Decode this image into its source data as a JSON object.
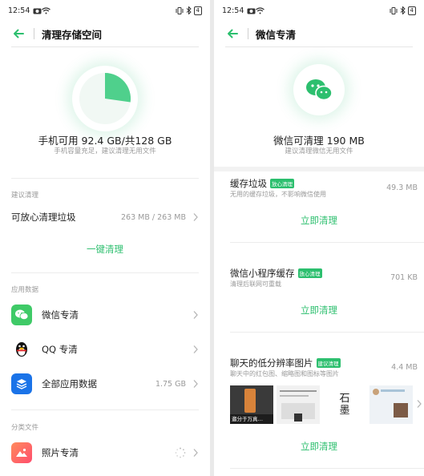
{
  "left": {
    "status": {
      "time": "12:54",
      "battery": "4"
    },
    "header": {
      "title": "清理存储空间"
    },
    "storage": {
      "main": "手机可用 92.4 GB/共128 GB",
      "sub": "手机容量充足，建议清理无用文件"
    },
    "suggest": {
      "label": "建议清理",
      "row_label": "可放心清理垃圾",
      "row_value": "263 MB / 263 MB",
      "action": "一键清理"
    },
    "apps": {
      "label": "应用数据",
      "items": [
        {
          "label": "微信专清",
          "value": ""
        },
        {
          "label": "QQ 专清",
          "value": ""
        },
        {
          "label": "全部应用数据",
          "value": "1.75 GB"
        }
      ]
    },
    "files": {
      "label": "分类文件",
      "items": [
        {
          "label": "照片专清",
          "value": ""
        }
      ]
    }
  },
  "right": {
    "status": {
      "time": "12:54",
      "battery": "4"
    },
    "header": {
      "title": "微信专清"
    },
    "summary": {
      "main": "微信可清理 190 MB",
      "sub": "建议清理微信无用文件"
    },
    "items": [
      {
        "title": "缓存垃圾",
        "badge": "放心清理",
        "desc": "无用的缓存垃圾，不影响微信使用",
        "size": "49.3 MB",
        "action": "立即清理"
      },
      {
        "title": "微信小程序缓存",
        "badge": "放心清理",
        "desc": "清理后联网可重载",
        "size": "701 KB",
        "action": "立即清理"
      },
      {
        "title": "聊天的低分辨率图片",
        "badge": "建议清理",
        "desc": "聊天中的红包图、缩略图和图标等图片",
        "size": "4.4 MB",
        "action": "立即清理"
      }
    ],
    "thumb_texts": {
      "t1": "遛分于万真…",
      "t4": "石\n墨"
    }
  },
  "colors": {
    "accent": "#2cbf6e",
    "wechat": "#3fca67",
    "qq_bg": "#ffffff",
    "all_apps": "#1a73e8",
    "photos": "#ff5b5b"
  }
}
